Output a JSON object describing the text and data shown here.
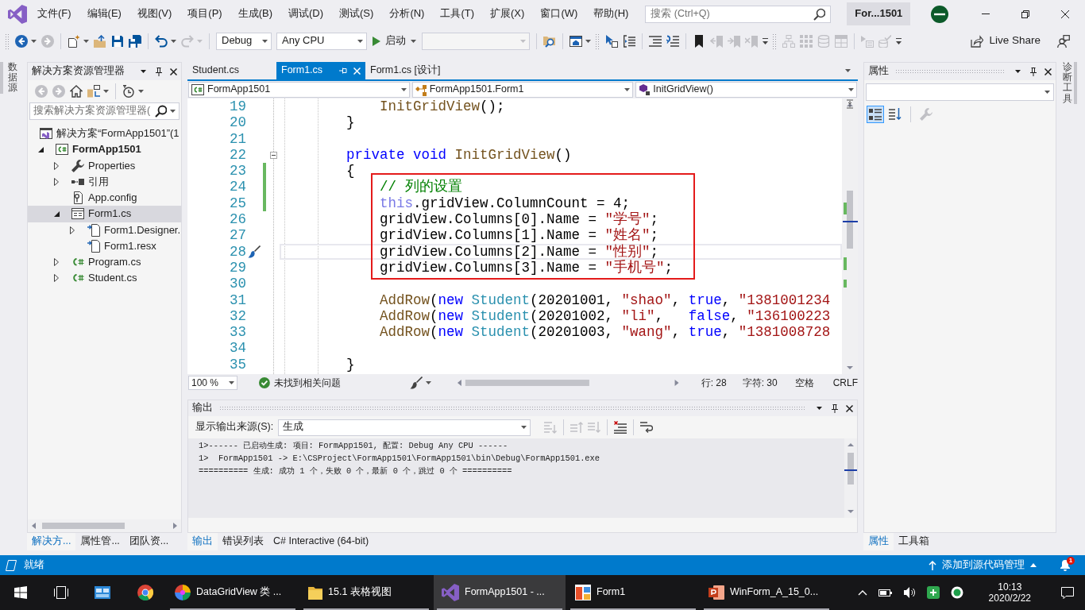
{
  "title_bar": {
    "menu": [
      "文件(F)",
      "编辑(E)",
      "视图(V)",
      "项目(P)",
      "生成(B)",
      "调试(D)",
      "测试(S)",
      "分析(N)",
      "工具(T)",
      "扩展(X)",
      "窗口(W)",
      "帮助(H)"
    ],
    "search": {
      "placeholder": "搜索 (Ctrl+Q)"
    },
    "solution_name": "For...1501"
  },
  "toolbar": {
    "groups": [
      [
        {
          "kind": "icon",
          "disabled": false,
          "dropdown": true
        },
        {
          "kind": "icon",
          "disabled": true
        }
      ],
      [
        {
          "kind": "icon",
          "disabled": false,
          "dropdown": true
        },
        {
          "kind": "icon",
          "disabled": false
        },
        {
          "kind": "icon",
          "disabled": false
        },
        {
          "kind": "icon",
          "disabled": false
        }
      ],
      [
        {
          "kind": "icon",
          "disabled": false,
          "dropdown": true
        },
        {
          "kind": "icon",
          "disabled": true,
          "dropdown": true
        }
      ],
      [
        {
          "kind": "combo",
          "value": "Debug",
          "disabled": false
        },
        {
          "kind": "combo",
          "value": "Any CPU",
          "disabled": false
        },
        {
          "kind": "run",
          "label": "启动",
          "dropdown": true
        },
        {
          "kind": "combo",
          "disabled": true
        }
      ],
      [
        {
          "kind": "icon",
          "disabled": false
        }
      ],
      [
        {
          "kind": "icon",
          "disabled": false,
          "dropdown": true
        }
      ],
      [
        {
          "kind": "icon",
          "disabled": false
        },
        {
          "kind": "icon",
          "disabled": false
        }
      ],
      [
        {
          "kind": "icon",
          "disabled": false
        },
        {
          "kind": "icon",
          "disabled": false
        }
      ],
      [
        {
          "kind": "icon",
          "disabled": false
        },
        {
          "kind": "icon",
          "disabled": true
        },
        {
          "kind": "icon",
          "disabled": true
        },
        {
          "kind": "icon",
          "disabled": true
        },
        {
          "kind": "overflow"
        }
      ],
      [
        {
          "kind": "icon",
          "disabled": true
        },
        {
          "kind": "icon",
          "disabled": true
        },
        {
          "kind": "icon",
          "disabled": true
        },
        {
          "kind": "icon",
          "disabled": true
        }
      ],
      [
        {
          "kind": "icon",
          "disabled": true
        },
        {
          "kind": "icon",
          "disabled": true
        },
        {
          "kind": "overflow"
        }
      ]
    ],
    "share": {
      "label": "Live Share"
    }
  },
  "left_dock": {
    "tabs": [
      "数据源"
    ]
  },
  "solution_explorer": {
    "title": "解决方案资源管理器",
    "toolbar": [
      {
        "disabled": true
      },
      {
        "disabled": true
      },
      {
        "disabled": false
      },
      {
        "disabled": false,
        "dropdown": true
      },
      {
        "disabled": false,
        "dropdown": true
      }
    ],
    "search": {
      "placeholder": "搜索解决方案资源管理器("
    },
    "tree": [
      {
        "kind": "solution",
        "label": "解决方案“FormApp1501”(1",
        "selected": false,
        "children": [
          {
            "kind": "project",
            "label": "FormApp1501",
            "expanded": true,
            "selected": false,
            "children": [
              {
                "kind": "properties",
                "label": "Properties",
                "expanded": false,
                "selected": false
              },
              {
                "kind": "references",
                "label": "引用",
                "expanded": false,
                "selected": false
              },
              {
                "kind": "config",
                "label": "App.config",
                "selected": false
              },
              {
                "kind": "form",
                "label": "Form1.cs",
                "expanded": true,
                "selected": true,
                "children": [
                  {
                    "kind": "file",
                    "label": "Form1.Designer.",
                    "expanded": false,
                    "selected": false
                  },
                  {
                    "kind": "file",
                    "label": "Form1.resx",
                    "selected": false
                  }
                ]
              },
              {
                "kind": "code",
                "label": "Program.cs",
                "expanded": false,
                "selected": false
              },
              {
                "kind": "code",
                "label": "Student.cs",
                "expanded": false,
                "selected": false
              }
            ]
          }
        ]
      }
    ],
    "tabs": [
      {
        "label": "解决方...",
        "selected": true
      },
      {
        "label": "属性管...",
        "selected": false
      },
      {
        "label": "团队资...",
        "selected": false
      }
    ]
  },
  "editor": {
    "tabs": [
      {
        "label": "Student.cs",
        "selected": false
      },
      {
        "label": "Form1.cs",
        "selected": true
      },
      {
        "label": "Form1.cs [设计]",
        "selected": false
      }
    ],
    "navigation": [
      "FormApp1501",
      "FormApp1501.Form1",
      "InitGridView()"
    ],
    "blocks": [
      {
        "framed": false,
        "lines": [
          {
            "number": "19",
            "changed": false,
            "current": false,
            "tokens": [
              {
                "kind": "method",
                "text": "            InitGridView"
              },
              {
                "kind": "plain",
                "text": "();"
              }
            ]
          },
          {
            "number": "20",
            "changed": false,
            "current": false,
            "tokens": [
              {
                "kind": "plain",
                "text": "        }"
              }
            ]
          },
          {
            "number": "21",
            "changed": false,
            "current": false
          },
          {
            "number": "22",
            "changed": false,
            "current": false,
            "expanded": true,
            "tokens": [
              {
                "kind": "keyword",
                "text": "        private void "
              },
              {
                "kind": "method",
                "text": "InitGridView"
              },
              {
                "kind": "plain",
                "text": "()"
              }
            ]
          },
          {
            "number": "23",
            "changed": true,
            "current": false,
            "tokens": [
              {
                "kind": "plain",
                "text": "        {"
              }
            ]
          }
        ]
      },
      {
        "framed": true,
        "lines": [
          {
            "number": "24",
            "changed": true,
            "current": false,
            "tokens": [
              {
                "kind": "comment",
                "text": "            // 列的设置"
              }
            ]
          },
          {
            "number": "25",
            "changed": true,
            "current": false,
            "tokens": [
              {
                "kind": "faded",
                "text": "            this"
              },
              {
                "kind": "plain",
                "text": ".gridView.ColumnCount = 4;"
              }
            ]
          },
          {
            "number": "26",
            "changed": false,
            "current": false,
            "tokens": [
              {
                "kind": "plain",
                "text": "            gridView.Columns[0].Name = "
              },
              {
                "kind": "string",
                "text": "\"学号\""
              },
              {
                "kind": "plain",
                "text": ";"
              }
            ]
          },
          {
            "number": "27",
            "changed": false,
            "current": false,
            "tokens": [
              {
                "kind": "plain",
                "text": "            gridView.Columns[1].Name = "
              },
              {
                "kind": "string",
                "text": "\"姓名\""
              },
              {
                "kind": "plain",
                "text": ";"
              }
            ]
          },
          {
            "number": "28",
            "changed": false,
            "current": true,
            "tokens": [
              {
                "kind": "plain",
                "text": "            gridView.Columns[2].Name = "
              },
              {
                "kind": "string",
                "text": "\"性别\""
              },
              {
                "kind": "plain",
                "text": ";"
              }
            ]
          },
          {
            "number": "29",
            "changed": false,
            "current": false,
            "tokens": [
              {
                "kind": "plain",
                "text": "            gridView.Columns[3].Name = "
              },
              {
                "kind": "string",
                "text": "\"手机号\""
              },
              {
                "kind": "plain",
                "text": ";"
              }
            ]
          }
        ]
      },
      {
        "framed": false,
        "lines": [
          {
            "number": "30",
            "changed": false,
            "current": false
          },
          {
            "number": "31",
            "changed": false,
            "current": false,
            "tokens": [
              {
                "kind": "method",
                "text": "            AddRow"
              },
              {
                "kind": "plain",
                "text": "("
              },
              {
                "kind": "keyword",
                "text": "new "
              },
              {
                "kind": "type",
                "text": "Student"
              },
              {
                "kind": "plain",
                "text": "(20201001, "
              },
              {
                "kind": "string",
                "text": "\"shao\""
              },
              {
                "kind": "plain",
                "text": ", "
              },
              {
                "kind": "keyword",
                "text": "true"
              },
              {
                "kind": "plain",
                "text": ", "
              },
              {
                "kind": "string",
                "text": "\"1381001234"
              }
            ]
          },
          {
            "number": "32",
            "changed": false,
            "current": false,
            "tokens": [
              {
                "kind": "method",
                "text": "            AddRow"
              },
              {
                "kind": "plain",
                "text": "("
              },
              {
                "kind": "keyword",
                "text": "new "
              },
              {
                "kind": "type",
                "text": "Student"
              },
              {
                "kind": "plain",
                "text": "(20201002, "
              },
              {
                "kind": "string",
                "text": "\"li\""
              },
              {
                "kind": "plain",
                "text": ",   "
              },
              {
                "kind": "keyword",
                "text": "false"
              },
              {
                "kind": "plain",
                "text": ", "
              },
              {
                "kind": "string",
                "text": "\"136100223"
              }
            ]
          },
          {
            "number": "33",
            "changed": false,
            "current": false,
            "tokens": [
              {
                "kind": "method",
                "text": "            AddRow"
              },
              {
                "kind": "plain",
                "text": "("
              },
              {
                "kind": "keyword",
                "text": "new "
              },
              {
                "kind": "type",
                "text": "Student"
              },
              {
                "kind": "plain",
                "text": "(20201003, "
              },
              {
                "kind": "string",
                "text": "\"wang\""
              },
              {
                "kind": "plain",
                "text": ", "
              },
              {
                "kind": "keyword",
                "text": "true"
              },
              {
                "kind": "plain",
                "text": ", "
              },
              {
                "kind": "string",
                "text": "\"1381008728"
              }
            ]
          },
          {
            "number": "34",
            "changed": false,
            "current": false
          },
          {
            "number": "35",
            "changed": false,
            "current": false,
            "tokens": [
              {
                "kind": "plain",
                "text": "        }"
              }
            ]
          }
        ]
      }
    ],
    "status": {
      "zoom": "100 %",
      "issues": "未找到相关问题",
      "line": "行: 28",
      "column": "字符: 30",
      "indent": "空格",
      "line_ending": "CRLF"
    }
  },
  "output": {
    "title": "输出",
    "source_label": "显示输出来源(S):",
    "source": "生成",
    "toolbar": [
      {
        "disabled": true
      },
      {
        "disabled": true
      },
      {
        "disabled": true
      },
      {
        "disabled": false
      },
      {
        "disabled": false
      }
    ],
    "lines": [
      "1>------ 已启动生成: 项目: FormApp1501, 配置: Debug Any CPU ------",
      "1>  FormApp1501 -> E:\\CSProject\\FormApp1501\\FormApp1501\\bin\\Debug\\FormApp1501.exe",
      "========== 生成: 成功 1 个，失败 0 个，最新 0 个，跳过 0 个 =========="
    ],
    "tabs": [
      {
        "label": "输出",
        "selected": true
      },
      {
        "label": "错误列表",
        "selected": false
      },
      {
        "label": "C# Interactive (64-bit)",
        "selected": false
      }
    ]
  },
  "properties": {
    "title": "属性",
    "toolbar": [
      {
        "selected": true,
        "disabled": false
      },
      {
        "selected": false,
        "disabled": false
      },
      {
        "selected": false,
        "disabled": true
      }
    ],
    "tabs": [
      {
        "label": "属性",
        "selected": true
      },
      {
        "label": "工具箱",
        "selected": false
      }
    ]
  },
  "right_dock": {
    "tabs": [
      "诊断工具"
    ]
  },
  "status_bar": {
    "message": "就绪",
    "source_control": "添加到源代码管理",
    "notification_count": "1"
  },
  "taskbar": {
    "items": [
      {
        "selected": false,
        "running": false
      },
      {
        "selected": false,
        "running": false
      },
      {
        "selected": false,
        "running": false
      },
      {
        "selected": false,
        "running": false
      },
      {
        "label": "DataGridView 类 ...",
        "selected": false,
        "running": true
      },
      {
        "label": "15.1 表格视图",
        "selected": false,
        "running": true
      },
      {
        "label": "FormApp1501 - ...",
        "selected": true,
        "running": true
      },
      {
        "label": "Form1",
        "selected": false,
        "running": true
      },
      {
        "label": "WinForm_A_15_0...",
        "selected": false,
        "running": true
      }
    ],
    "time": "10:13",
    "date": "2020/2/22"
  }
}
